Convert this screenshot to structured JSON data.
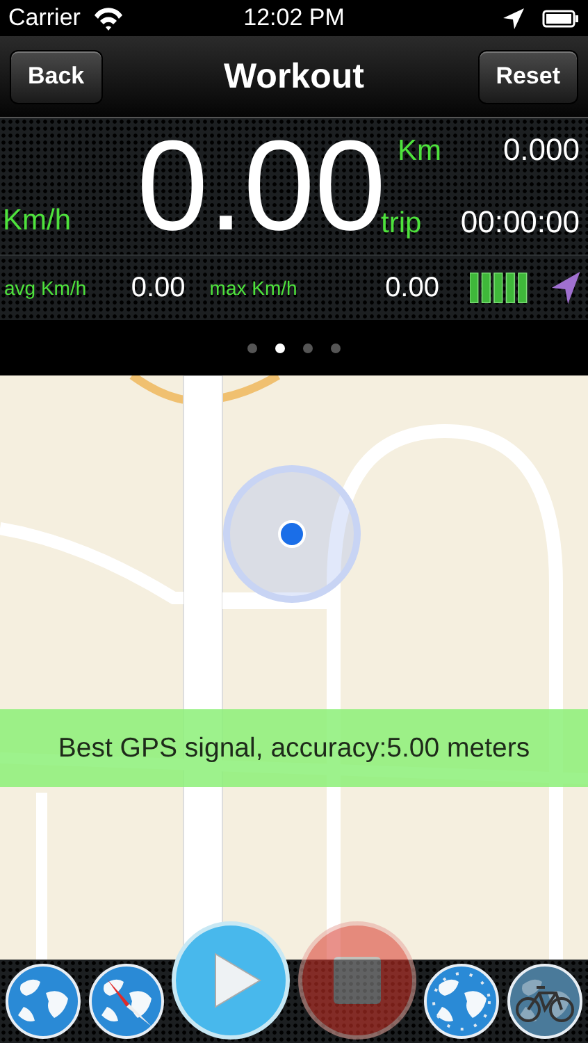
{
  "status_bar": {
    "carrier": "Carrier",
    "time": "12:02 PM"
  },
  "nav_bar": {
    "back": "Back",
    "title": "Workout",
    "reset": "Reset"
  },
  "dashboard": {
    "speed": "0.00",
    "speed_unit": "Km/h",
    "distance_unit": "Km",
    "distance": "0.000",
    "trip_label": "trip",
    "trip_time": "00:00:00",
    "avg_label": "avg Km/h",
    "avg": "0.00",
    "max_label": "max Km/h",
    "max": "0.00"
  },
  "pages": [
    {
      "selected": false
    },
    {
      "selected": true
    },
    {
      "selected": false
    },
    {
      "selected": false
    }
  ],
  "map": {
    "kind": "picture",
    "banner": "Best GPS signal, accuracy:5.00 meters"
  },
  "toolbar": [
    {
      "kind": "globe",
      "disabled": false
    },
    {
      "kind": "compass",
      "disabled": false
    },
    {
      "kind": "play",
      "disabled": false
    },
    {
      "kind": "stop",
      "disabled": true
    },
    {
      "kind": "clock",
      "disabled": false
    },
    {
      "kind": "bike",
      "disabled": false
    }
  ]
}
